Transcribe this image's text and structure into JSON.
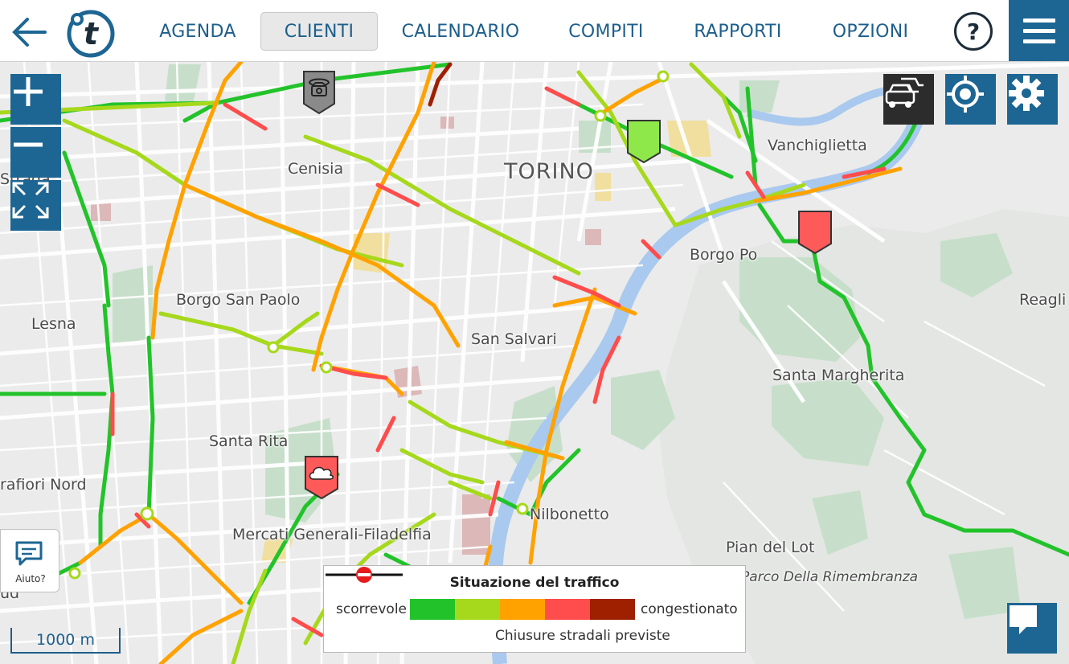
{
  "header": {
    "nav": [
      {
        "label": "AGENDA",
        "active": false
      },
      {
        "label": "CLIENTI",
        "active": true
      },
      {
        "label": "CALENDARIO",
        "active": false
      },
      {
        "label": "COMPITI",
        "active": false
      },
      {
        "label": "RAPPORTI",
        "active": false
      },
      {
        "label": "OPZIONI",
        "active": false
      }
    ],
    "help_label": "?",
    "back_icon": "arrow-left-icon",
    "logo_letter": "t",
    "menu_icon": "hamburger-icon"
  },
  "map": {
    "labels": {
      "torino": "TORINO",
      "vanchiglietta": "Vanchiglietta",
      "cenisia": "Cenisia",
      "borgo_po": "Borgo Po",
      "borgo_san_paolo": "Borgo San Paolo",
      "lesna": "Lesna",
      "san_salvario": "San Salvari",
      "reaglie": "Reagli",
      "santa_margherita": "Santa Margherita",
      "santa_rita": "Santa Rita",
      "mirafiori_nord": "rafiori Nord",
      "nizza": "Nilbonetto",
      "mercati": "Mercati Generali-Filadelfia",
      "pian_del_lot": "Pian del Lot",
      "parco": "Parco Della Rimembranza",
      "strada": "Strada",
      "lud": "ud"
    },
    "controls": {
      "zoom_in_icon": "plus-icon",
      "zoom_out_icon": "minus-icon",
      "fullscreen_icon": "expand-icon",
      "traffic_icon": "traffic-cars-icon",
      "locate_icon": "crosshair-icon",
      "settings_icon": "gear-icon"
    },
    "scale_label": "1000 m",
    "help_bubble_label": "Aiuto?"
  },
  "legend": {
    "title": "Situazione del traffico",
    "left_label": "scorrevole",
    "right_label": "congestionato",
    "colors": [
      "#22c32a",
      "#a6d81c",
      "#ffa200",
      "#ff4c4c",
      "#9e2000"
    ],
    "closure_label": "Chiusure stradali previste"
  },
  "markers": [
    {
      "type": "phone",
      "color": "#8a8a8a",
      "icon": "phone-icon"
    },
    {
      "type": "plain",
      "color": "#8ee84a"
    },
    {
      "type": "plain",
      "color": "#ff5a5a"
    },
    {
      "type": "cloud",
      "color": "#ff5a5a",
      "icon": "cloud-icon"
    }
  ],
  "colors": {
    "brand": "#1d6693",
    "nav_text": "#1d5f8c",
    "river": "#a8c8f0",
    "park": "#c5dfc8"
  }
}
